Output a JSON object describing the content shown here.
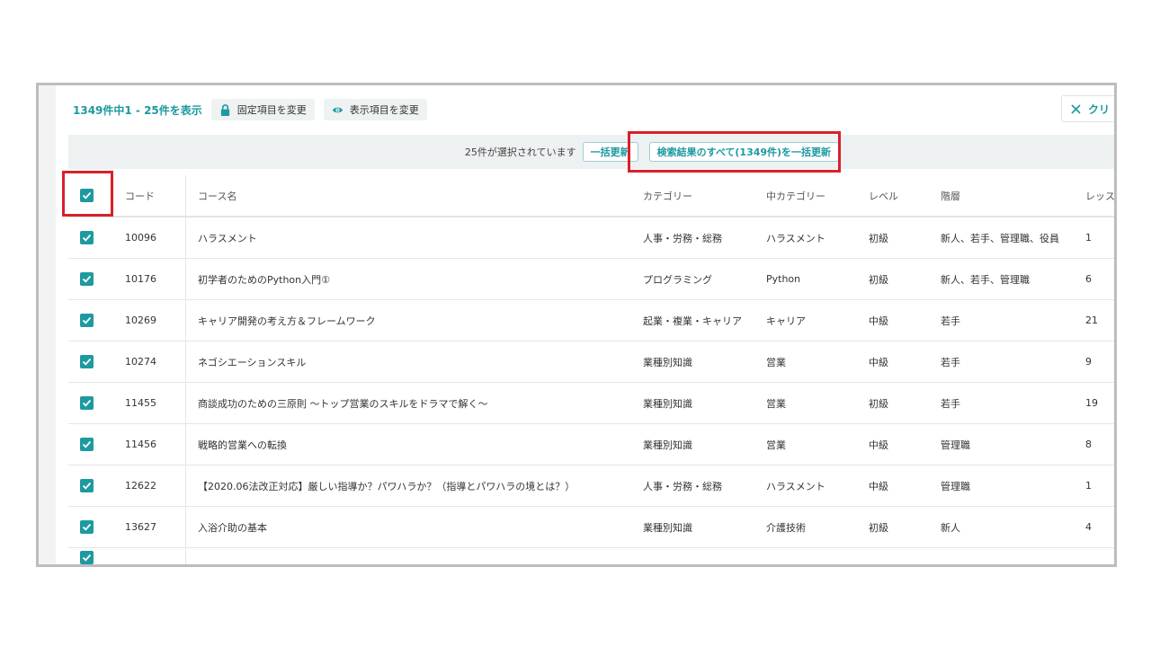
{
  "toolbar": {
    "count_text": "1349件中1 - 25件を表示",
    "fixed_items_label": "固定項目を変更",
    "display_items_label": "表示項目を変更",
    "clear_label": "クリ"
  },
  "selection": {
    "message": "25件が選択されています",
    "bulk_update_label": "一括更新",
    "bulk_update_all_label": "検索結果のすべて(1349件)を一括更新"
  },
  "table": {
    "headers": {
      "code": "コード",
      "name": "コース名",
      "category": "カテゴリー",
      "mid_category": "中カテゴリー",
      "level": "レベル",
      "tier": "階層",
      "lessons": "レッスン"
    },
    "rows": [
      {
        "code": "10096",
        "name": "ハラスメント",
        "category": "人事・労務・総務",
        "mid_category": "ハラスメント",
        "level": "初級",
        "tier": "新人、若手、管理職、役員",
        "lessons": "1"
      },
      {
        "code": "10176",
        "name": "初学者のためのPython入門①",
        "category": "プログラミング",
        "mid_category": "Python",
        "level": "初級",
        "tier": "新人、若手、管理職",
        "lessons": "6"
      },
      {
        "code": "10269",
        "name": "キャリア開発の考え方＆フレームワーク",
        "category": "起業・複業・キャリア",
        "mid_category": "キャリア",
        "level": "中級",
        "tier": "若手",
        "lessons": "21"
      },
      {
        "code": "10274",
        "name": "ネゴシエーションスキル",
        "category": "業種別知識",
        "mid_category": "営業",
        "level": "中級",
        "tier": "若手",
        "lessons": "9"
      },
      {
        "code": "11455",
        "name": "商談成功のための三原則 〜トップ営業のスキルをドラマで解く〜",
        "category": "業種別知識",
        "mid_category": "営業",
        "level": "初級",
        "tier": "若手",
        "lessons": "19"
      },
      {
        "code": "11456",
        "name": "戦略的営業への転換",
        "category": "業種別知識",
        "mid_category": "営業",
        "level": "中級",
        "tier": "管理職",
        "lessons": "8"
      },
      {
        "code": "12622",
        "name": "【2020.06法改正対応】厳しい指導か？パワハラか？（指導とパワハラの境とは？）",
        "category": "人事・労務・総務",
        "mid_category": "ハラスメント",
        "level": "中級",
        "tier": "管理職",
        "lessons": "1"
      },
      {
        "code": "13627",
        "name": "入浴介助の基本",
        "category": "業種別知識",
        "mid_category": "介護技術",
        "level": "初級",
        "tier": "新人",
        "lessons": "4"
      }
    ]
  },
  "colors": {
    "accent": "#1d9aa0",
    "highlight": "#d9202a"
  }
}
